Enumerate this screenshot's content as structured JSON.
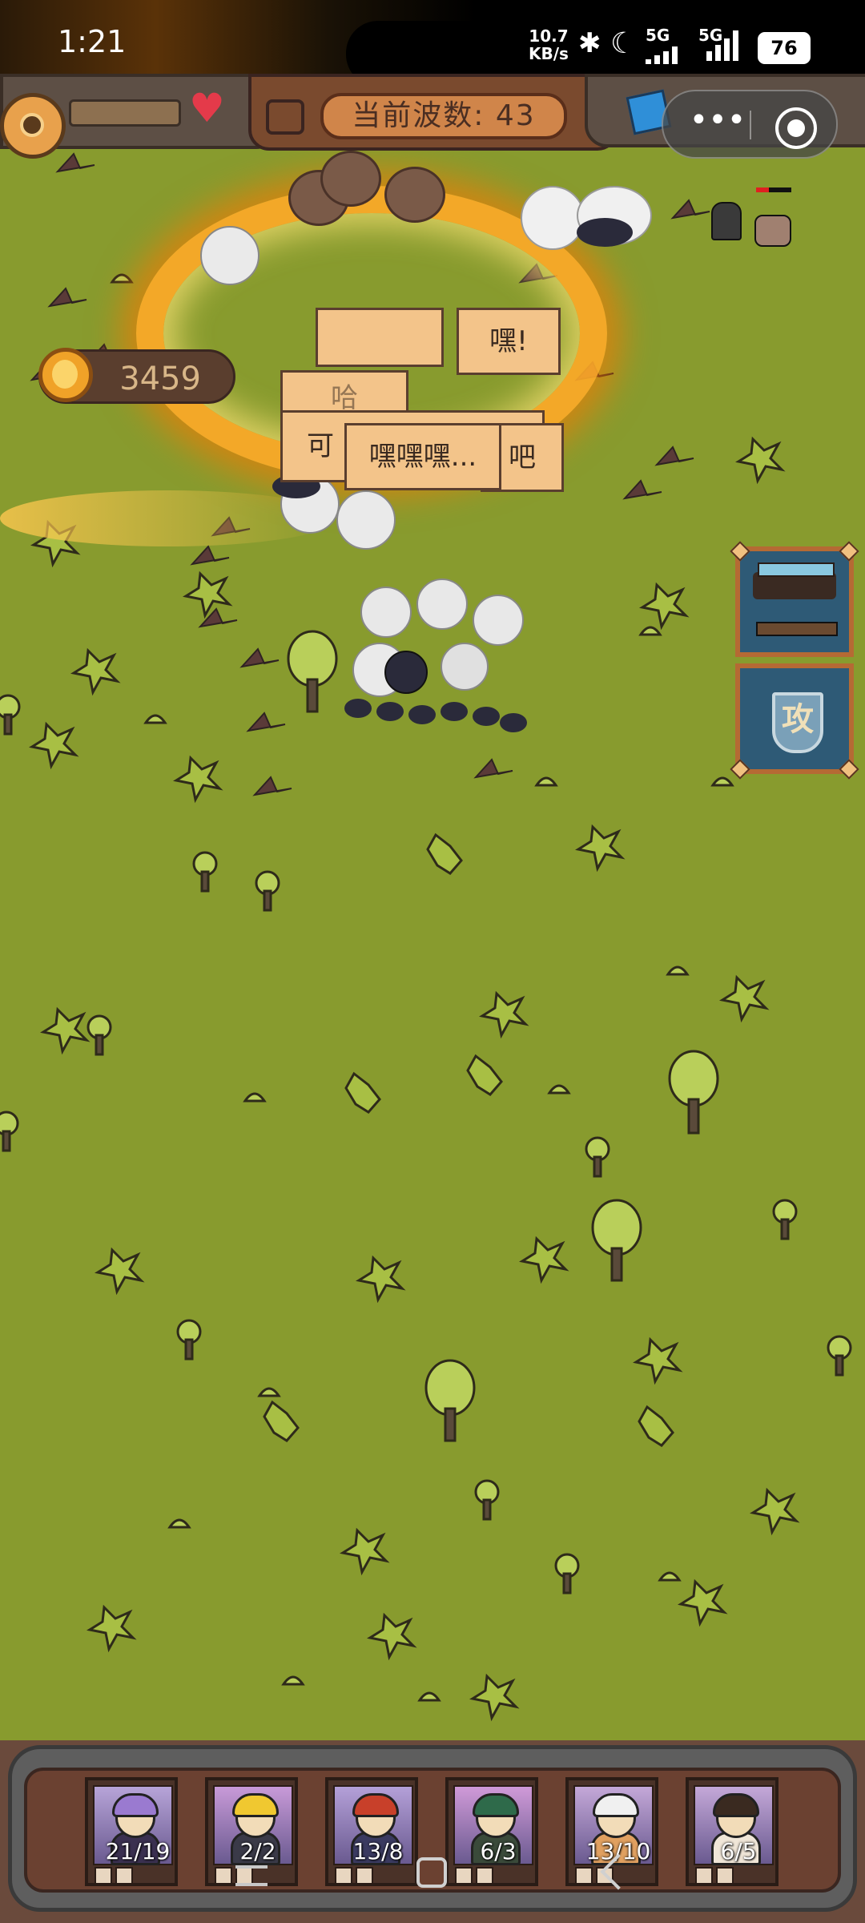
{
  "status_bar": {
    "time": "1:21",
    "net_speed_value": "10.7",
    "net_speed_unit": "KB/s",
    "sim1_label": "5G",
    "sim2_label": "5G",
    "battery": "76"
  },
  "hud": {
    "wave_label": "当前波数: 43",
    "gold": "3459"
  },
  "speech_bubbles": {
    "b1": "嘿!",
    "b2": "嘿嘿嘿...",
    "b3": "可",
    "b4": "吧",
    "b5": "哈"
  },
  "side_buttons": {
    "attack_glyph": "攻"
  },
  "heroes": [
    {
      "count": "21/19",
      "portrait_color": "#b7a4d8",
      "hair_color": "#9a7ad0",
      "body_color": "#3a3050"
    },
    {
      "count": "2/2",
      "portrait_color": "#c89ad8",
      "hair_color": "#f0c830",
      "body_color": "#3a3a48"
    },
    {
      "count": "13/8",
      "portrait_color": "#b4a0d8",
      "hair_color": "#c8402a",
      "body_color": "#3a3a60"
    },
    {
      "count": "6/3",
      "portrait_color": "#d09ad8",
      "hair_color": "#2e6a4a",
      "body_color": "#3a4a3a"
    },
    {
      "count": "13/10",
      "portrait_color": "#c4a8d8",
      "hair_color": "#f0f0f0",
      "body_color": "#e0a060"
    },
    {
      "count": "6/5",
      "portrait_color": "#c4a8d8",
      "hair_color": "#3a2a20",
      "body_color": "#f0e6d8"
    }
  ],
  "colors": {
    "field_grass": "#889b2e",
    "panel_brown": "#6b4131",
    "fire": "#ffaa28",
    "heart": "#e43a4a"
  },
  "icons": [
    "settings-gear-icon",
    "heart-icon",
    "wave-flag-icon",
    "treasure-cube-icon",
    "more-dots-icon",
    "close-target-icon",
    "gold-coin-icon",
    "weapons-rack-icon",
    "attack-shield-icon"
  ]
}
